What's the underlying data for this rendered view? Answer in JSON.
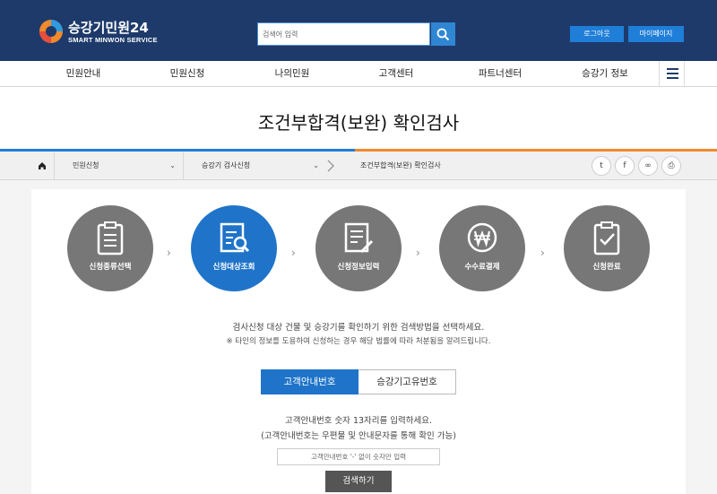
{
  "header": {
    "logo_title": "승강기민원24",
    "logo_subtitle": "SMART MINWON SERVICE",
    "search_placeholder": "검색어 입력",
    "logout_label": "로그아웃",
    "mypage_label": "마이페이지",
    "brand_color": "#1e3a6b",
    "accent_color": "#1f7ed8"
  },
  "nav": {
    "items": [
      "민원안내",
      "민원신청",
      "나의민원",
      "고객센터",
      "파트너센터",
      "승강기 정보"
    ]
  },
  "page": {
    "title": "조건부합격(보완) 확인검사"
  },
  "breadcrumb": {
    "items": [
      "민원신청",
      "승강기 검사신청",
      "조건부합격(보완) 확인검사"
    ],
    "share_icons": [
      "twitter-icon",
      "facebook-icon",
      "link-icon",
      "print-icon"
    ]
  },
  "steps": [
    {
      "label": "신청종류선택",
      "icon": "clipboard-icon",
      "active": false
    },
    {
      "label": "신청대상조회",
      "icon": "document-search-icon",
      "active": true
    },
    {
      "label": "신청정보입력",
      "icon": "document-edit-icon",
      "active": false
    },
    {
      "label": "수수료결제",
      "icon": "won-icon",
      "active": false
    },
    {
      "label": "신청완료",
      "icon": "checklist-icon",
      "active": false
    }
  ],
  "description": {
    "line1": "검사신청 대상 건물 및 승강기를 확인하기 위한 검색방법을 선택하세요.",
    "line2": "※ 타인의 정보를 도용하여 신청하는 경우 해당 법률에 따라 처분됨을 알려드립니다."
  },
  "tabs": {
    "active": "고객안내번호",
    "inactive": "승강기고유번호"
  },
  "instructions": {
    "line1": "고객안내번호 숫자 13자리를 입력하세요.",
    "line2": "(고객안내번호는 우편물 및 안내문자를 통해 확인 가능)"
  },
  "form": {
    "code_placeholder": "고객안내번호 '-' 없이 숫자만 입력",
    "submit_label": "검색하기"
  }
}
